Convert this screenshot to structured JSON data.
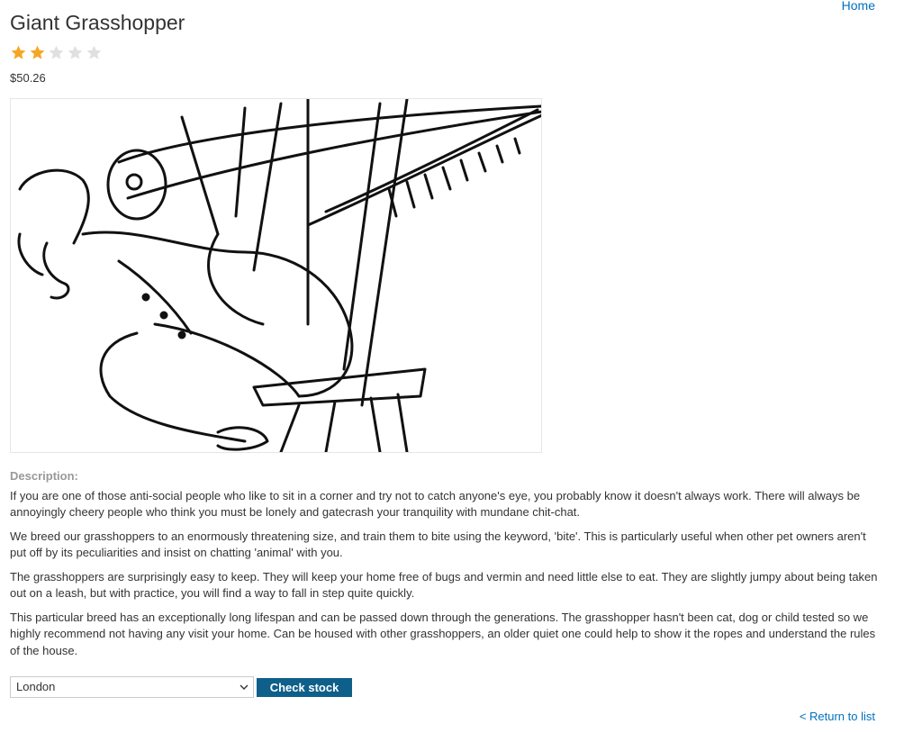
{
  "nav": {
    "home_label": "Home"
  },
  "product": {
    "title": "Giant Grasshopper",
    "rating": {
      "value": 2,
      "max": 5,
      "filled_color": "#f5a623",
      "empty_color": "#e0e0e0"
    },
    "price": "$50.26",
    "image_icon": "grasshopper-illustration"
  },
  "description": {
    "label": "Description:",
    "paragraphs": [
      "If you are one of those anti-social people who like to sit in a corner and try not to catch anyone's eye, you probably know it doesn't always work. There will always be annoyingly cheery people who think you must be lonely and gatecrash your tranquility with mundane chit-chat.",
      "We breed our grasshoppers to an enormously threatening size, and train them to bite using the keyword, 'bite'. This is particularly useful when other pet owners aren't put off by its peculiarities and insist on chatting 'animal' with you.",
      "The grasshoppers are surprisingly easy to keep. They will keep your home free of bugs and vermin and need little else to eat. They are slightly jumpy about being taken out on a leash, but with practice, you will find a way to fall in step quite quickly.",
      "This particular breed has an exceptionally long lifespan and can be passed down through the generations. The grasshopper hasn't been cat, dog or child tested so we highly recommend not having any visit your home. Can be housed with other grasshoppers, an older quiet one could help to show it the ropes and understand the rules of the house."
    ]
  },
  "stock": {
    "selected_store": "London",
    "check_label": "Check stock",
    "button_color": "#0e5f8a"
  },
  "footer": {
    "return_label": "< Return to list"
  }
}
